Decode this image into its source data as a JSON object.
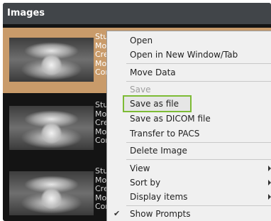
{
  "panel": {
    "title": "Images"
  },
  "images": [
    {
      "meta": [
        "Stu",
        "Mo",
        "Cre",
        "Mo",
        "Cor"
      ],
      "selected": true
    },
    {
      "meta": [
        "Stu",
        "Mo",
        "Cre",
        "Mo",
        "Cor"
      ],
      "selected": false
    },
    {
      "meta": [
        "Stu",
        "Mo",
        "Cre",
        "Mo",
        "Cor"
      ],
      "selected": false
    }
  ],
  "context_menu": {
    "items": [
      {
        "label": "Open"
      },
      {
        "label": "Open in New Window/Tab"
      },
      {
        "label": "Move Data"
      },
      {
        "label": "Save",
        "disabled": true
      },
      {
        "label": "Save as file",
        "highlighted": true
      },
      {
        "label": "Save as DICOM file"
      },
      {
        "label": "Transfer to PACS"
      },
      {
        "label": "Delete Image"
      },
      {
        "label": "View",
        "submenu": true
      },
      {
        "label": "Sort by",
        "submenu": true
      },
      {
        "label": "Display items",
        "submenu": true
      },
      {
        "label": "Show Prompts",
        "checked": true
      }
    ],
    "highlight_color": "#7dbb35"
  }
}
